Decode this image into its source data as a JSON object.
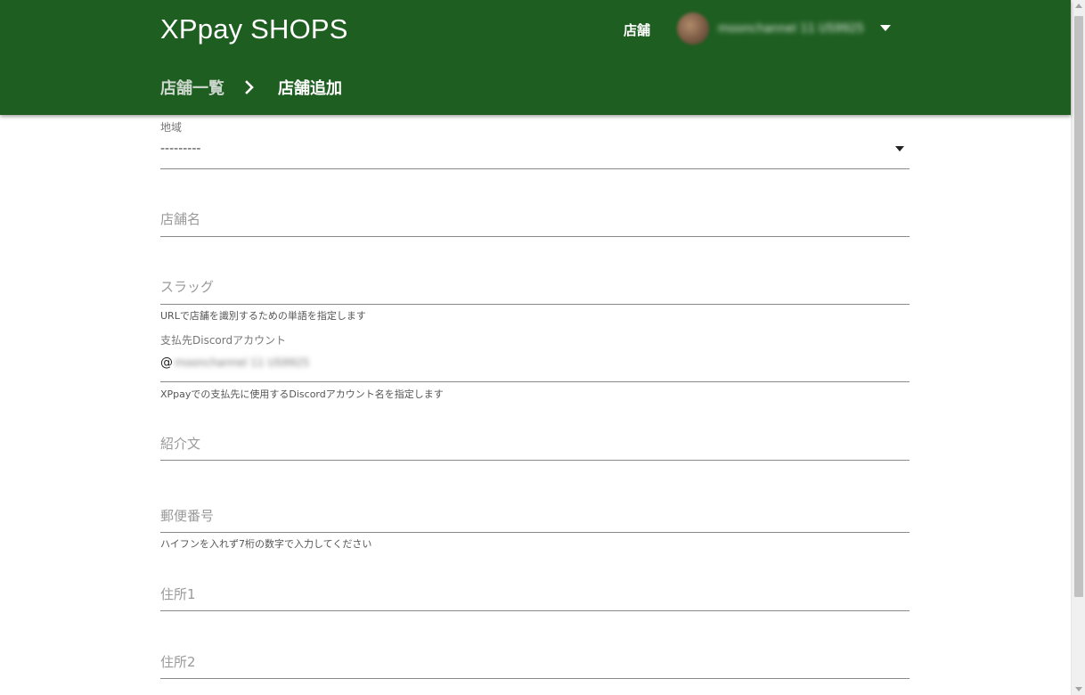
{
  "header": {
    "brand": "XPpay SHOPS",
    "nav_shop": "店舗",
    "user_name": "moonchannel 11 US9925",
    "breadcrumb": {
      "parent": "店舗一覧",
      "current": "店舗追加"
    }
  },
  "form": {
    "region": {
      "label": "地域",
      "value": "---------"
    },
    "shop_name": {
      "placeholder": "店舗名"
    },
    "slug": {
      "placeholder": "スラッグ",
      "helper": "URLで店舗を識別するための単語を指定します"
    },
    "discord": {
      "label": "支払先Discordアカウント",
      "prefix": "@",
      "value": "moonchannel 11 US9925",
      "helper": "XPpayでの支払先に使用するDiscordアカウント名を指定します"
    },
    "intro": {
      "placeholder": "紹介文"
    },
    "postal": {
      "placeholder": "郵便番号",
      "helper": "ハイフンを入れず7桁の数字で入力してください"
    },
    "address1": {
      "placeholder": "住所1"
    },
    "address2": {
      "placeholder": "住所2"
    }
  },
  "colors": {
    "appbar": "#1e5e21",
    "underline": "#8a8a8a"
  },
  "icons": [
    "chevron-right-icon",
    "caret-down-icon",
    "avatar"
  ]
}
